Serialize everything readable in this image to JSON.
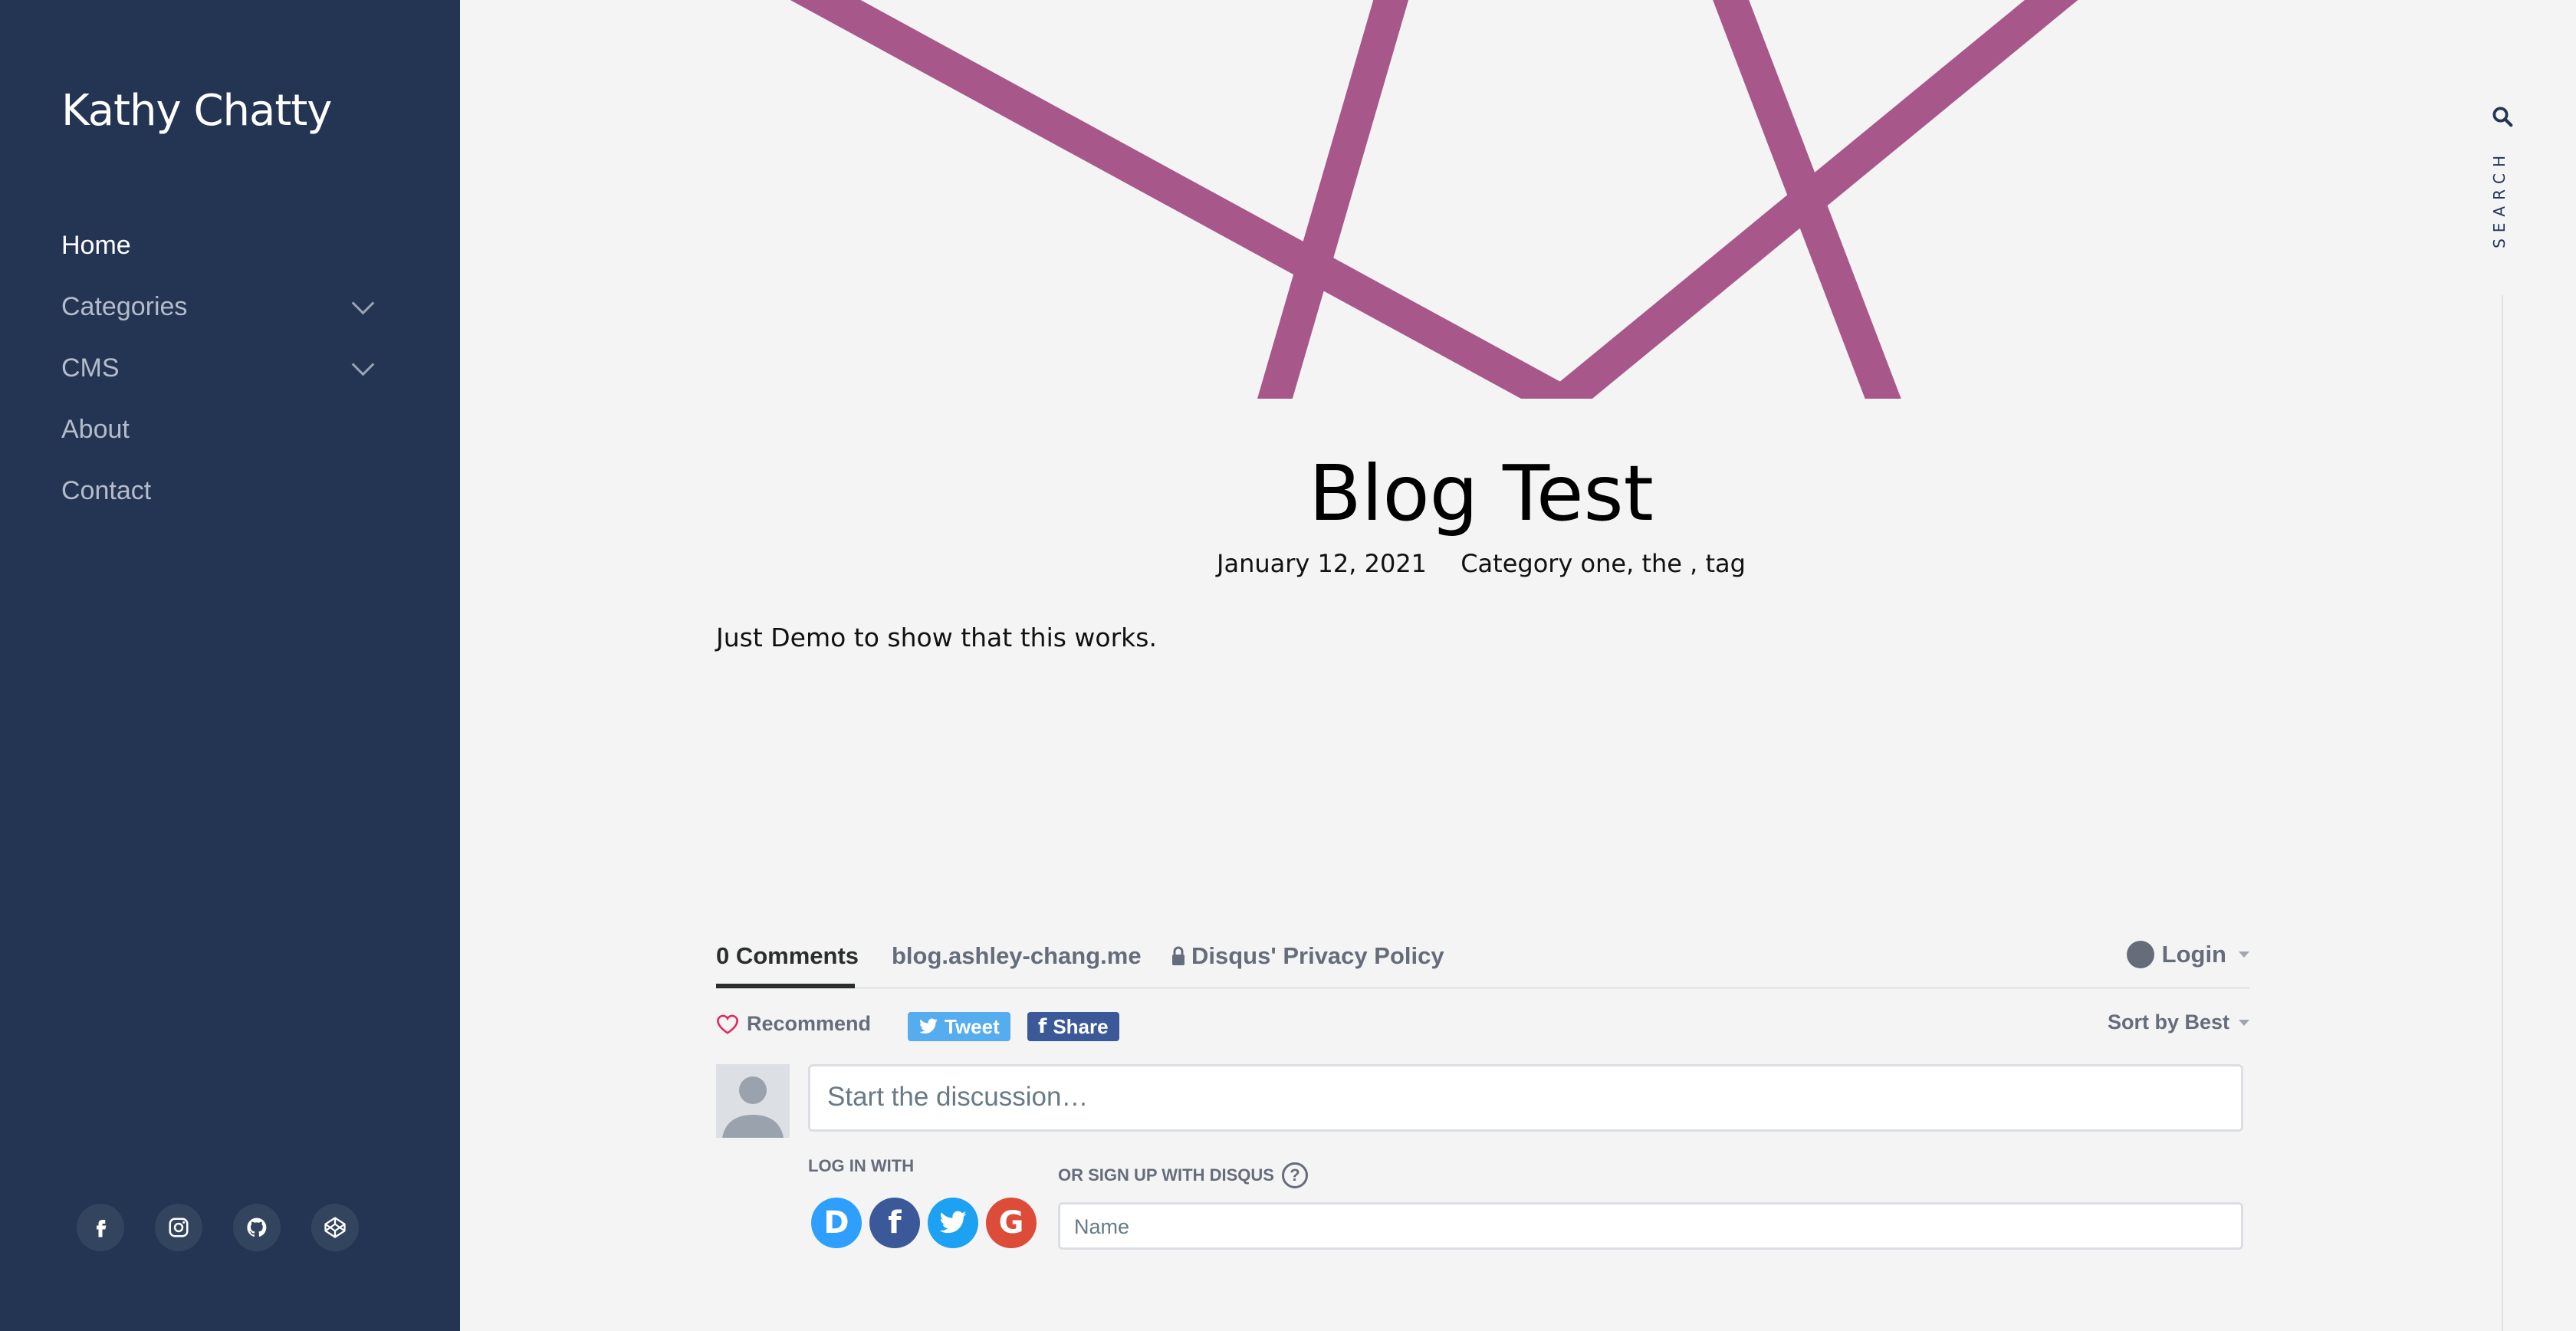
{
  "sidebar": {
    "brand": "Kathy Chatty",
    "nav": [
      {
        "label": "Home",
        "active": true,
        "has_children": false
      },
      {
        "label": "Categories",
        "active": false,
        "has_children": true
      },
      {
        "label": "CMS",
        "active": false,
        "has_children": true
      },
      {
        "label": "About",
        "active": false,
        "has_children": false
      },
      {
        "label": "Contact",
        "active": false,
        "has_children": false
      }
    ],
    "socials": [
      "facebook-icon",
      "instagram-icon",
      "github-icon",
      "codepen-icon"
    ]
  },
  "search": {
    "label": "SEARCH",
    "icon": "search-icon"
  },
  "post": {
    "title": "Blog Test",
    "date": "January 12, 2021",
    "categories": "Category one, the , tag",
    "body": "Just Demo to show that this works."
  },
  "disqus": {
    "tabs": {
      "comments": "0 Comments",
      "site": "blog.ashley-chang.me",
      "privacy": "Disqus' Privacy Policy"
    },
    "login": "Login",
    "recommend": "Recommend",
    "tweet": "Tweet",
    "share": "Share",
    "sort": "Sort by Best",
    "placeholder": "Start the discussion…",
    "login_with": "LOG IN WITH",
    "or_signup": "OR SIGN UP WITH DISQUS",
    "help": "?",
    "name_placeholder": "Name",
    "providers": [
      {
        "name": "disqus",
        "glyph": "D",
        "color": "#2e9fff"
      },
      {
        "name": "facebook",
        "glyph": "f",
        "color": "#3b5998"
      },
      {
        "name": "twitter",
        "glyph": "t",
        "color": "#1da1f2"
      },
      {
        "name": "google",
        "glyph": "G",
        "color": "#dd4b39"
      }
    ]
  },
  "colors": {
    "sidebar_bg": "#243554",
    "page_bg": "#f4f4f4",
    "hero_stroke": "#a8578a"
  }
}
